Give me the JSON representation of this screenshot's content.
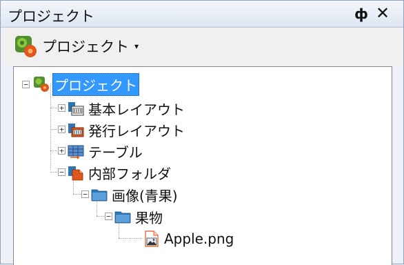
{
  "window": {
    "title": "プロジェクト",
    "pin_glyph": "ф",
    "close_glyph": "✕"
  },
  "toolbar": {
    "project_button_label": "プロジェクト",
    "dropdown_glyph": "▾"
  },
  "tree": {
    "root": {
      "label": "プロジェクト",
      "icon": "project-gear-icon",
      "selected": true
    },
    "items": [
      {
        "label": "基本レイアウト",
        "icon": "basic-layout-icon"
      },
      {
        "label": "発行レイアウト",
        "icon": "publish-layout-icon"
      },
      {
        "label": "テーブル",
        "icon": "table-icon"
      },
      {
        "label": "内部フォルダ",
        "icon": "internal-folder-icon"
      },
      {
        "label": "画像(青果)",
        "icon": "folder-icon"
      },
      {
        "label": "果物",
        "icon": "folder-icon"
      },
      {
        "label": "Apple.png",
        "icon": "image-file-icon"
      }
    ]
  },
  "colors": {
    "selection": "#3399ff",
    "folder": "#2f76b6",
    "accent_orange": "#e0561b"
  }
}
